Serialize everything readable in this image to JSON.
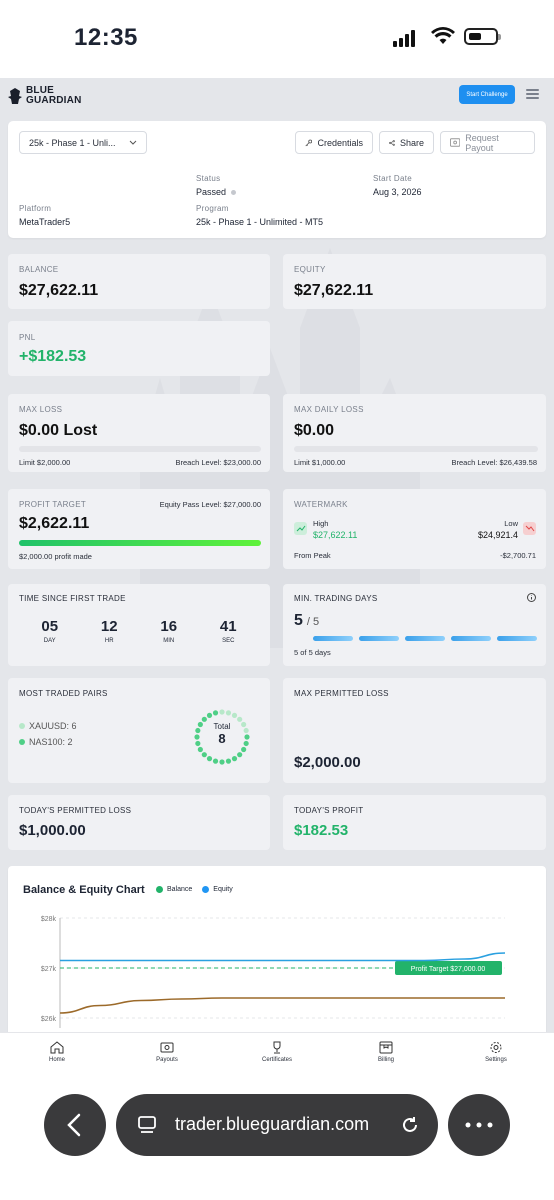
{
  "status_bar": {
    "time": "12:35"
  },
  "header": {
    "logo_line1": "BLUE",
    "logo_line2": "GUARDIAN",
    "start_button": "Start Challenge"
  },
  "account": {
    "selector": "25k - Phase 1 - Unli...",
    "credentials": "Credentials",
    "share": "Share",
    "request_payout": "Request Payout",
    "status_label": "Status",
    "status_value": "Passed",
    "start_date_label": "Start Date",
    "start_date_value": "Aug 3, 2026",
    "platform_label": "Platform",
    "platform_value": "MetaTrader5",
    "program_label": "Program",
    "program_value": "25k - Phase 1 - Unlimited - MT5"
  },
  "balance": {
    "label": "BALANCE",
    "value": "$27,622.11"
  },
  "equity": {
    "label": "EQUITY",
    "value": "$27,622.11"
  },
  "pnl": {
    "label": "PNL",
    "value": "+$182.53"
  },
  "max_loss": {
    "label": "MAX LOSS",
    "value": "$0.00 Lost",
    "limit": "Limit $2,000.00",
    "breach": "Breach Level: $23,000.00"
  },
  "max_daily_loss": {
    "label": "MAX DAILY LOSS",
    "value": "$0.00",
    "limit": "Limit $1,000.00",
    "breach": "Breach Level: $26,439.58"
  },
  "profit_target": {
    "label": "PROFIT TARGET",
    "pass_level": "Equity Pass Level: $27,000.00",
    "value": "$2,622.11",
    "progress": 1.0,
    "note": "$2,000.00 profit made"
  },
  "watermark": {
    "label": "WATERMARK",
    "high_label": "High",
    "high_value": "$27,622.11",
    "low_label": "Low",
    "low_value": "$24,921.4",
    "from_peak_label": "From Peak",
    "from_peak_value": "-$2,700.71"
  },
  "time_since": {
    "label": "TIME SINCE FIRST TRADE",
    "units": [
      {
        "value": "05",
        "unit": "DAY"
      },
      {
        "value": "12",
        "unit": "HR"
      },
      {
        "value": "16",
        "unit": "MIN"
      },
      {
        "value": "41",
        "unit": "SEC"
      }
    ]
  },
  "trading_days": {
    "label": "MIN. TRADING DAYS",
    "value": "5",
    "total": "/ 5",
    "note": "5 of 5 days",
    "completed": 5,
    "required": 5
  },
  "pairs": {
    "label": "MOST TRADED PAIRS",
    "items": [
      {
        "name": "XAUUSD: 6"
      },
      {
        "name": "NAS100: 2"
      }
    ],
    "total_label": "Total",
    "total_value": "8"
  },
  "max_permitted": {
    "label": "MAX PERMITTED LOSS",
    "value": "$2,000.00"
  },
  "today_permitted": {
    "label": "TODAY'S PERMITTED LOSS",
    "value": "$1,000.00"
  },
  "today_profit": {
    "label": "TODAY'S PROFIT",
    "value": "$182.53"
  },
  "chart_data": {
    "type": "line",
    "title": "Balance & Equity Chart",
    "ylim": [
      26000,
      28000
    ],
    "y_ticks": [
      "$28k",
      "$27k",
      "$26k"
    ],
    "grid": true,
    "legend": "top",
    "series": [
      {
        "name": "Balance",
        "color": "#22b36a",
        "values": [
          26100,
          26250,
          26350,
          26380,
          26400,
          26400,
          26400,
          26400,
          26400,
          26400,
          26400,
          26400
        ]
      },
      {
        "name": "Equity",
        "color": "#2196f3",
        "values": [
          27150,
          27150,
          27150,
          27150,
          27150,
          27150,
          27150,
          27150,
          27150,
          27150,
          27180,
          27300
        ]
      }
    ],
    "annotation": "Profit Target $27,000.00",
    "target": 27000
  },
  "nav": {
    "items": [
      {
        "label": "Home"
      },
      {
        "label": "Payouts"
      },
      {
        "label": "Certificates"
      },
      {
        "label": "Billing"
      },
      {
        "label": "Settings"
      }
    ]
  },
  "browser": {
    "url": "trader.blueguardian.com"
  }
}
